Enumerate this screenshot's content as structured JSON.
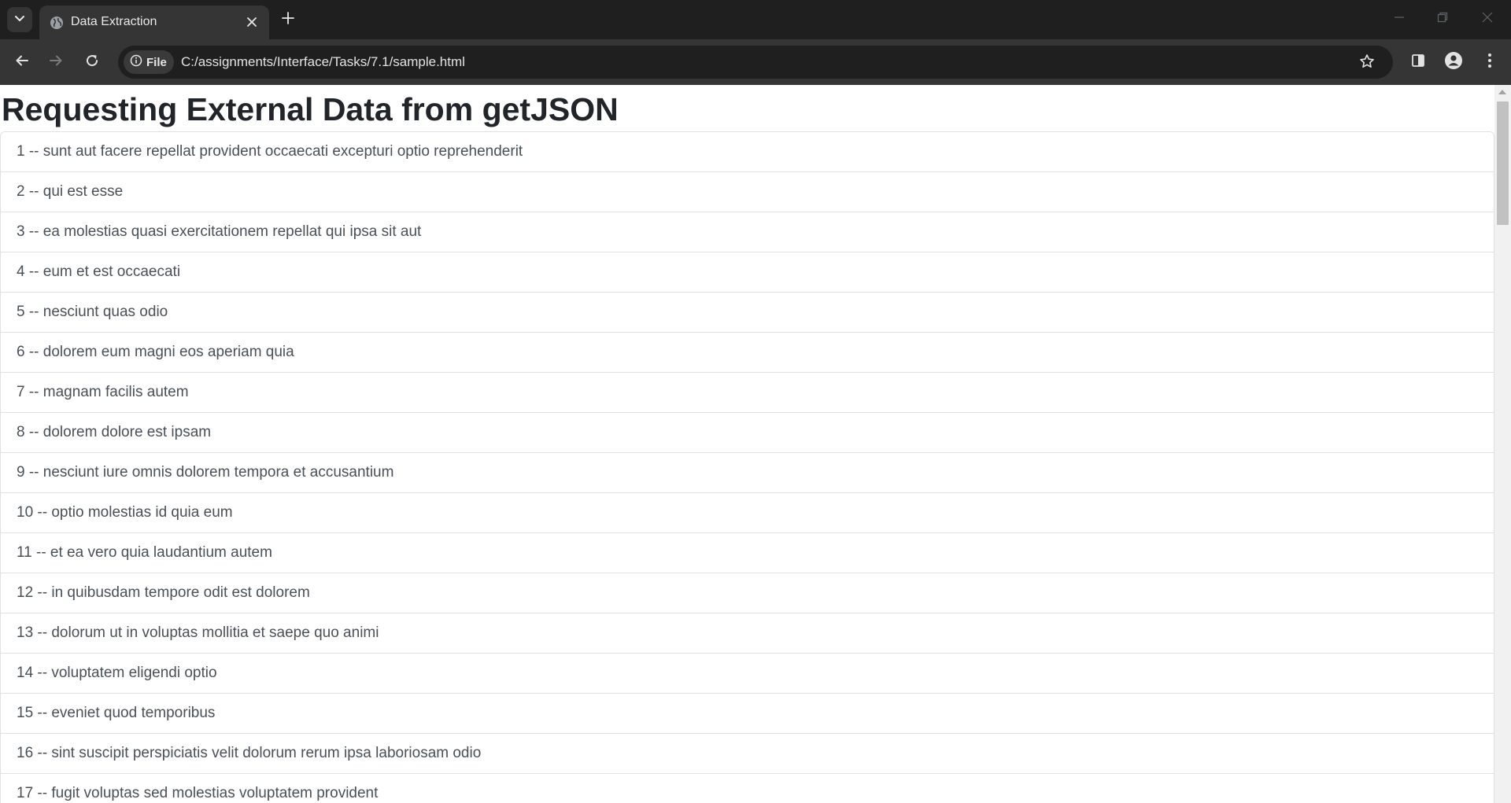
{
  "browser": {
    "tab_title": "Data Extraction",
    "url": "C:/assignments/Interface/Tasks/7.1/sample.html",
    "chip_label": "File",
    "icons": [
      "tab-search-icon",
      "globe-icon",
      "close-icon",
      "plus-icon",
      "minimize-icon",
      "restore-icon",
      "window-close-icon",
      "back-arrow-icon",
      "forward-arrow-icon",
      "reload-icon",
      "info-icon",
      "star-icon",
      "side-panel-icon",
      "profile-icon",
      "kebab-menu-icon"
    ],
    "colors": {
      "tabstrip": "#1f1f1f",
      "toolbar": "#353535",
      "omnibox": "#1f1f1f"
    }
  },
  "page": {
    "title": "Requesting External Data from getJSON",
    "items": [
      "1 -- sunt aut facere repellat provident occaecati excepturi optio reprehenderit",
      "2 -- qui est esse",
      "3 -- ea molestias quasi exercitationem repellat qui ipsa sit aut",
      "4 -- eum et est occaecati",
      "5 -- nesciunt quas odio",
      "6 -- dolorem eum magni eos aperiam quia",
      "7 -- magnam facilis autem",
      "8 -- dolorem dolore est ipsam",
      "9 -- nesciunt iure omnis dolorem tempora et accusantium",
      "10 -- optio molestias id quia eum",
      "11 -- et ea vero quia laudantium autem",
      "12 -- in quibusdam tempore odit est dolorem",
      "13 -- dolorum ut in voluptas mollitia et saepe quo animi",
      "14 -- voluptatem eligendi optio",
      "15 -- eveniet quod temporibus",
      "16 -- sint suscipit perspiciatis velit dolorum rerum ipsa laboriosam odio",
      "17 -- fugit voluptas sed molestias voluptatem provident"
    ],
    "colors": {
      "text": "#495057",
      "heading": "#212529",
      "border": "#dee2e6"
    }
  }
}
